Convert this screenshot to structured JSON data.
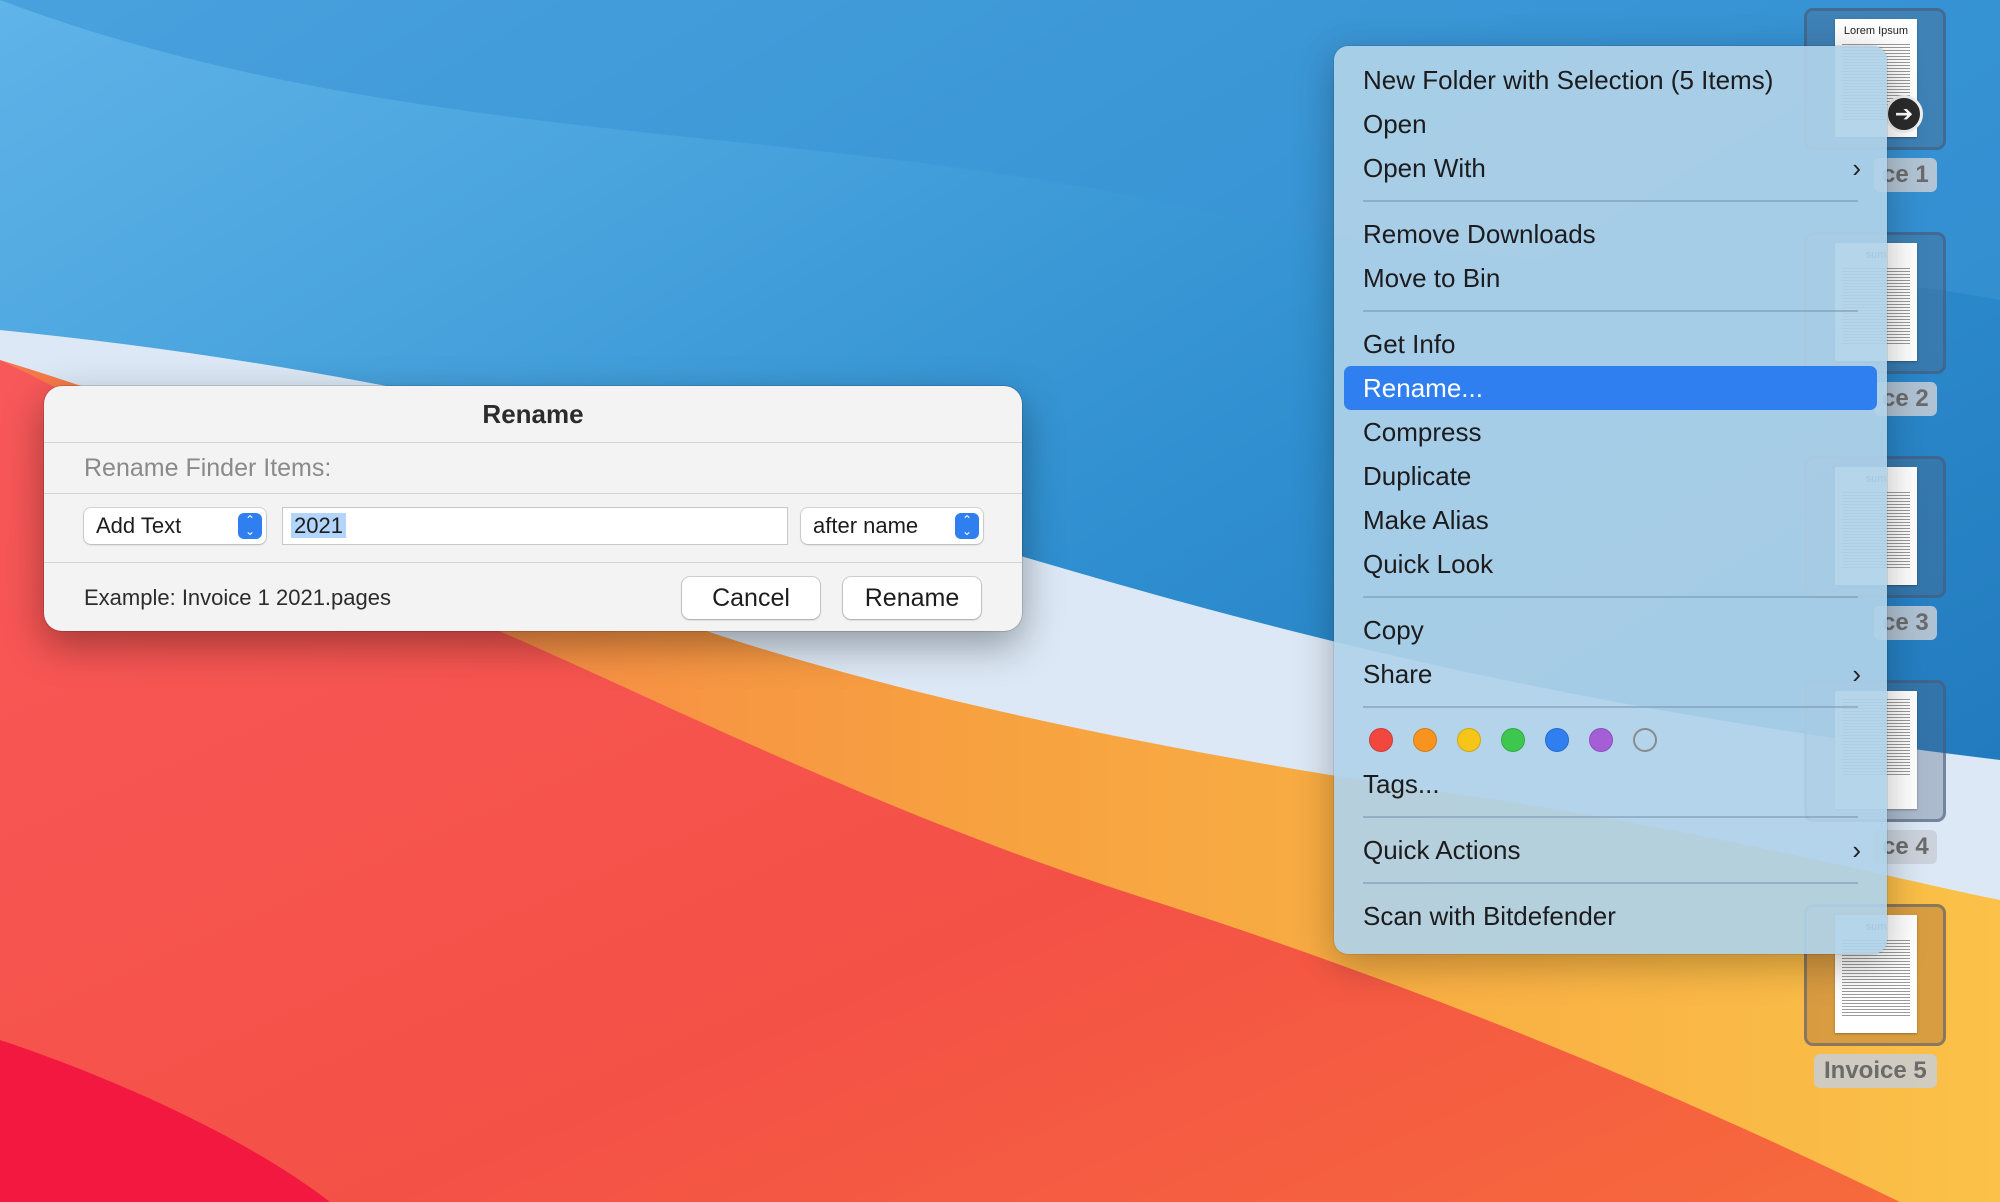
{
  "desktop": {
    "files": [
      {
        "label": "ce 1",
        "page_title": "Lorem Ipsum"
      },
      {
        "label": "ce 2",
        "page_title": "sum"
      },
      {
        "label": "ce 3",
        "page_title": "sum"
      },
      {
        "label": "ce 4",
        "page_title": ""
      },
      {
        "label": "Invoice 5",
        "page_title": "sum"
      }
    ],
    "arrow_glyph": "➔"
  },
  "context_menu": {
    "items": [
      {
        "label": "New Folder with Selection (5 Items)"
      },
      {
        "label": "Open"
      },
      {
        "label": "Open With",
        "submenu": true
      },
      {
        "label": "Remove Downloads"
      },
      {
        "label": "Move to Bin"
      },
      {
        "label": "Get Info"
      },
      {
        "label": "Rename...",
        "highlighted": true
      },
      {
        "label": "Compress"
      },
      {
        "label": "Duplicate"
      },
      {
        "label": "Make Alias"
      },
      {
        "label": "Quick Look"
      },
      {
        "label": "Copy"
      },
      {
        "label": "Share",
        "submenu": true
      },
      {
        "label": "Tags..."
      },
      {
        "label": "Quick Actions",
        "submenu": true
      },
      {
        "label": "Scan with Bitdefender"
      }
    ],
    "chevron": "›",
    "tag_colors": [
      "#f2473f",
      "#f7931e",
      "#f5c518",
      "#3ec74e",
      "#2f7ff0",
      "#a45fd6",
      "none"
    ]
  },
  "dialog": {
    "title": "Rename",
    "subtitle": "Rename Finder Items:",
    "mode_select": "Add Text",
    "text_value": "2021",
    "position_select": "after name",
    "example": "Example: Invoice 1 2021.pages",
    "cancel_label": "Cancel",
    "rename_label": "Rename"
  }
}
